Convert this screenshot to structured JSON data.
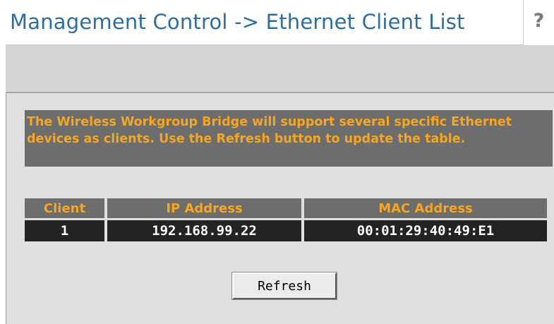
{
  "header": {
    "title": "Management Control -> Ethernet Client List",
    "help_label": "?"
  },
  "info": {
    "text": "The Wireless Workgroup Bridge will support several specific Ethernet devices as clients. Use the Refresh button to update the table."
  },
  "table": {
    "headers": {
      "client": "Client",
      "ip": "IP Address",
      "mac": "MAC Address"
    },
    "rows": [
      {
        "client": "1",
        "ip": "192.168.99.22",
        "mac": "00:01:29:40:49:E1"
      }
    ]
  },
  "actions": {
    "refresh_label": "Refresh"
  },
  "colors": {
    "title": "#2e6d9e",
    "accent_orange": "#f5a623",
    "header_gray": "#6d6d6d",
    "row_dark": "#232323",
    "panel_bg": "#e0e0e0"
  }
}
